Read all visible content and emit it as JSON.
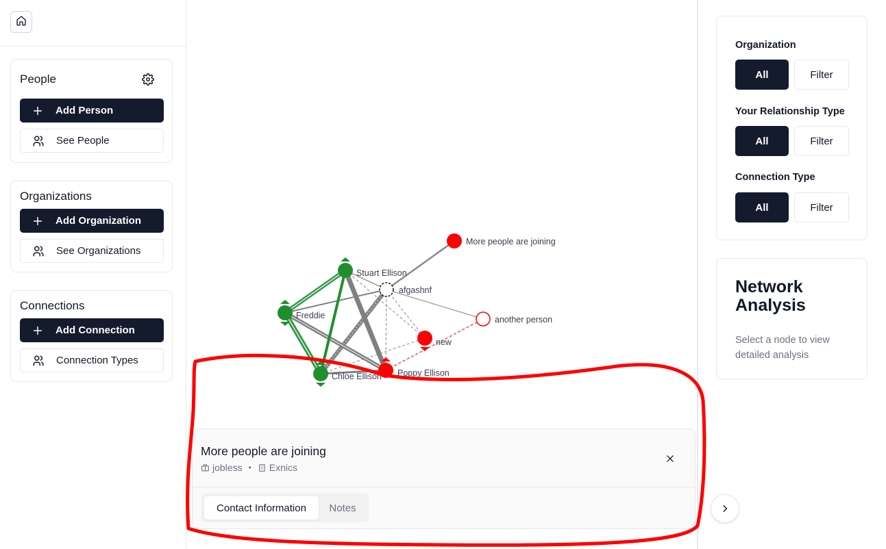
{
  "sidebar": {
    "people": {
      "title": "People",
      "add_label": "Add Person",
      "see_label": "See People"
    },
    "organizations": {
      "title": "Organizations",
      "add_label": "Add Organization",
      "see_label": "See Organizations"
    },
    "connections": {
      "title": "Connections",
      "add_label": "Add Connection",
      "see_label": "Connection Types"
    }
  },
  "graph": {
    "nodes": [
      {
        "label": "More people are joining",
        "color": "#ff0000",
        "style": "filled"
      },
      {
        "label": "Stuart Ellison",
        "color": "#1f8f2e",
        "style": "filled"
      },
      {
        "label": "afgashnf",
        "color": "#ffffff",
        "style": "dashed-outline"
      },
      {
        "label": "Freddie",
        "color": "#1f8f2e",
        "style": "filled"
      },
      {
        "label": "another person",
        "color": "#ffffff",
        "style": "red-outline"
      },
      {
        "label": "new",
        "color": "#ff0000",
        "style": "filled"
      },
      {
        "label": "Poppy Ellison",
        "color": "#ff0000",
        "style": "filled"
      },
      {
        "label": "Chloe Ellison",
        "color": "#1f8f2e",
        "style": "filled"
      }
    ]
  },
  "detail": {
    "name": "More people are joining",
    "job": "jobless",
    "separator": "•",
    "organization": "Exnics",
    "tabs": [
      {
        "label": "Contact Information",
        "active": true
      },
      {
        "label": "Notes",
        "active": false
      }
    ]
  },
  "filters": [
    {
      "label": "Organization",
      "all": "All",
      "filter": "Filter"
    },
    {
      "label": "Your Relationship Type",
      "all": "All",
      "filter": "Filter"
    },
    {
      "label": "Connection Type",
      "all": "All",
      "filter": "Filter"
    }
  ],
  "network_analysis": {
    "title": "Network Analysis",
    "description": "Select a node to view detailed analysis"
  },
  "icons": {
    "home": "home-icon",
    "settings": "gear-icon",
    "plus": "plus-icon",
    "users": "users-icon",
    "close": "close-icon",
    "briefcase": "briefcase-icon",
    "building": "building-icon",
    "chevron": "chevron-right-icon"
  },
  "colors": {
    "primary": "#141b2d",
    "positive_node": "#1f8f2e",
    "negative_node": "#ff0000",
    "annotation": "#ff0000"
  }
}
